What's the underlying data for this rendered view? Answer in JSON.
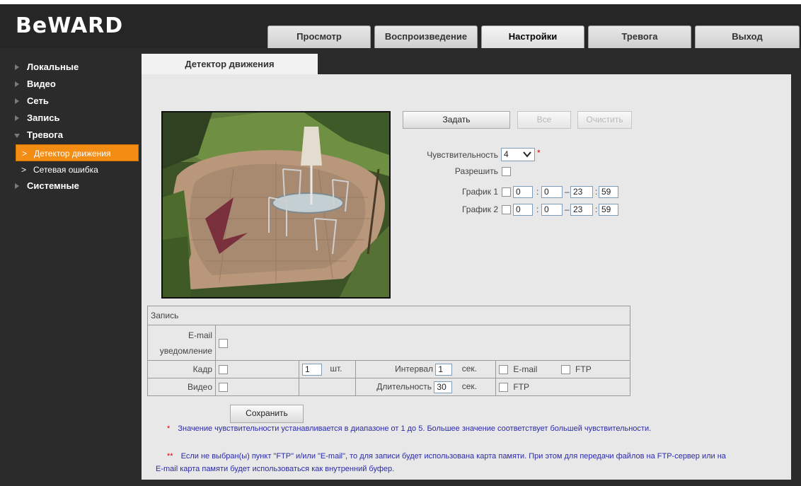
{
  "brand": {
    "logo_text": "BeWARD"
  },
  "top_tabs": [
    {
      "label": "Просмотр"
    },
    {
      "label": "Воспроизведение"
    },
    {
      "label": "Настройки"
    },
    {
      "label": "Тревога"
    },
    {
      "label": "Выход"
    }
  ],
  "sidebar": {
    "items": [
      {
        "label": "Локальные"
      },
      {
        "label": "Видео"
      },
      {
        "label": "Сеть"
      },
      {
        "label": "Запись"
      },
      {
        "label": "Тревога"
      }
    ],
    "subitems": [
      {
        "label": "Детектор движения"
      },
      {
        "label": "Сетевая ошибка"
      }
    ],
    "last_item": {
      "label": "Системные"
    }
  },
  "page": {
    "tab_title": "Детектор движения"
  },
  "area_buttons": {
    "set": "Задать",
    "all": "Все",
    "clear": "Очистить"
  },
  "settings": {
    "sensitivity_label": "Чувствительность",
    "sensitivity_value": "4",
    "required_mark": "*",
    "enable_label": "Разрешить",
    "schedule1": {
      "label": "График 1",
      "h1": "0",
      "m1": "0",
      "h2": "23",
      "m2": "59"
    },
    "schedule2": {
      "label": "График 2",
      "h1": "0",
      "m1": "0",
      "h2": "23",
      "m2": "59"
    },
    "colon": ":",
    "dash": "–"
  },
  "record": {
    "header": "Запись",
    "email_label_1": "E-mail",
    "email_label_2": "уведомление",
    "frame_label": "Кадр",
    "frame_count": "1",
    "frame_unit": "шт.",
    "interval_label": "Интервал",
    "interval_value": "1",
    "sec": "сек.",
    "email": "E-mail",
    "ftp": "FTP",
    "video_label": "Видео",
    "duration_label": "Длительность",
    "duration_value": "30"
  },
  "save_button": "Сохранить",
  "notes": {
    "note1_mark": "*",
    "note1": "Значение чувствительности устанавливается в диапазоне от 1 до 5. Большее значение соответствует большей чувствительности.",
    "note2_mark": "**",
    "note2_line1": "Если не выбран(ы) пункт \"FTP\" и/или \"E-mail\", то для записи будет использована карта памяти. При этом для передачи файлов на FTP-сервер или на",
    "note2_line2": "E-mail карта памяти будет использоваться как внутренний буфер."
  },
  "colors": {
    "accent": "#f28c13",
    "dark_bg": "#2b2b2b",
    "panel": "#e8e8e8",
    "note_text": "#2b2ba8"
  }
}
